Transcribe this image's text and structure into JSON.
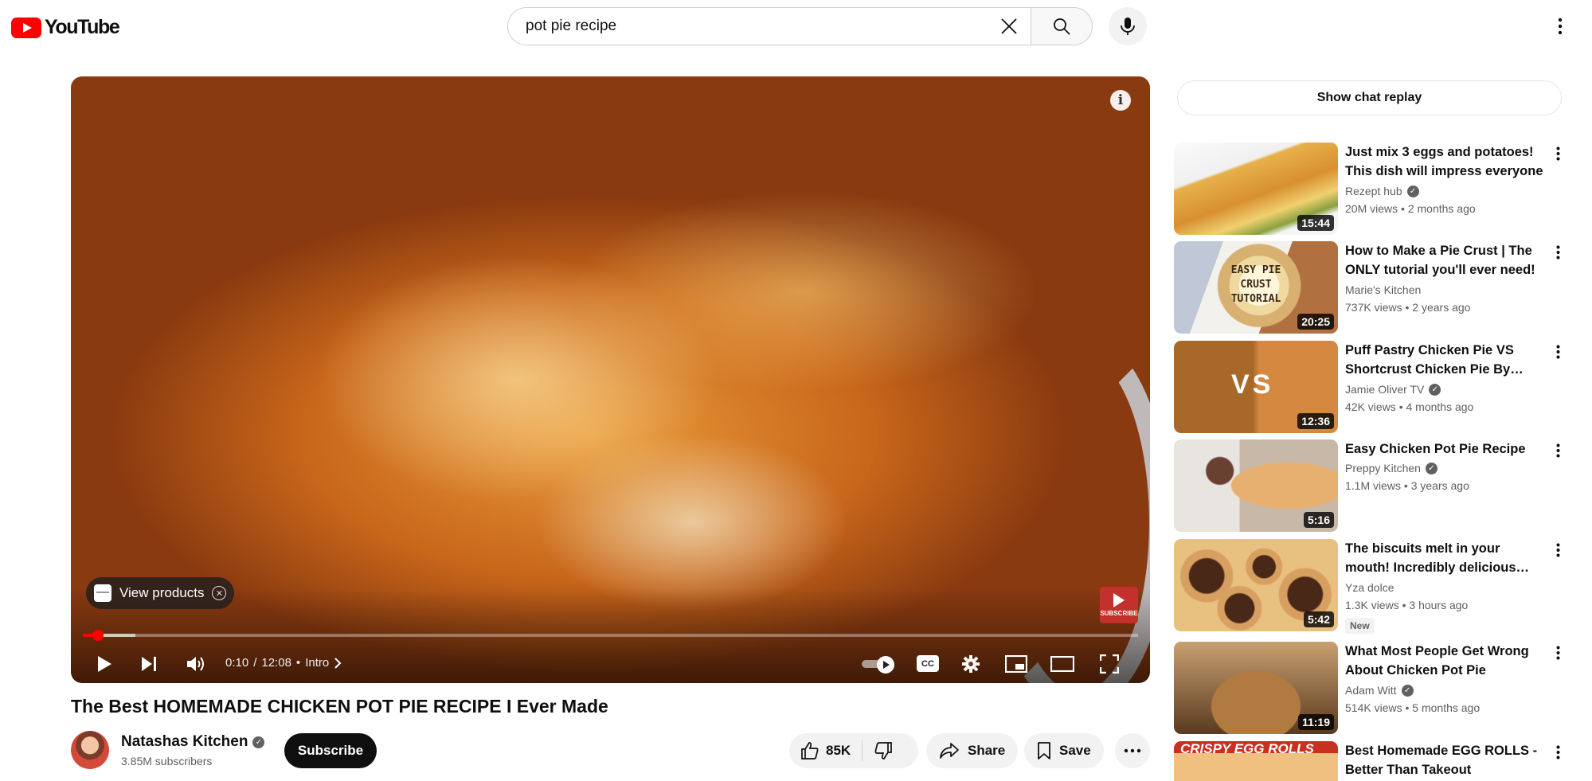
{
  "header": {
    "logo_text": "YouTube",
    "search_value": "pot pie recipe"
  },
  "player": {
    "view_products_label": "View products",
    "subscribe_badge_label": "SUBSCRIBE",
    "current_time": "0:10",
    "duration": "12:08",
    "chapter": "Intro",
    "progress_fraction": 0.014,
    "buffered_fraction": 0.05,
    "cc_label": "CC"
  },
  "video": {
    "title": "The Best HOMEMADE CHICKEN POT PIE RECIPE I Ever Made",
    "channel_name": "Natashas Kitchen",
    "subscribers": "3.85M subscribers",
    "subscribe_label": "Subscribe",
    "like_count": "85K",
    "share_label": "Share",
    "save_label": "Save"
  },
  "sidebar": {
    "chat_replay_label": "Show chat replay",
    "recommendations": [
      {
        "title": "Just mix 3 eggs and potatoes! This dish will impress everyone",
        "channel": "Rezept hub",
        "verified": true,
        "views": "20M views",
        "age": "2 months ago",
        "duration": "15:44",
        "badge": ""
      },
      {
        "title": "How to Make a Pie Crust | The ONLY tutorial you'll ever need!",
        "channel": "Marie's Kitchen",
        "verified": false,
        "views": "737K views",
        "age": "2 years ago",
        "duration": "20:25",
        "badge": "",
        "thumb_text": "EASY PIE CRUST TUTORIAL"
      },
      {
        "title": "Puff Pastry Chicken Pie VS Shortcrust Chicken Pie By Jamie Oliver",
        "channel": "Jamie Oliver TV",
        "verified": true,
        "views": "42K views",
        "age": "4 months ago",
        "duration": "12:36",
        "badge": "",
        "thumb_text": "VS"
      },
      {
        "title": "Easy Chicken Pot Pie Recipe",
        "channel": "Preppy Kitchen",
        "verified": true,
        "views": "1.1M views",
        "age": "3 years ago",
        "duration": "5:16",
        "badge": ""
      },
      {
        "title": "The biscuits melt in your mouth! Incredibly delicious with few ingredients",
        "channel": "Yza dolce",
        "verified": false,
        "views": "1.3K views",
        "age": "3 hours ago",
        "duration": "5:42",
        "badge": "New"
      },
      {
        "title": "What Most People Get Wrong About Chicken Pot Pie",
        "channel": "Adam Witt",
        "verified": true,
        "views": "514K views",
        "age": "5 months ago",
        "duration": "11:19",
        "badge": ""
      },
      {
        "title": "Best Homemade EGG ROLLS - Better Than Takeout",
        "channel": "",
        "verified": false,
        "views": "",
        "age": "",
        "duration": "",
        "badge": "",
        "thumb_text": "CRISPY EGG ROLLS"
      }
    ]
  },
  "colors": {
    "brand_red": "#ff0000",
    "text_primary": "#0f0f0f",
    "text_secondary": "#606060",
    "chip_bg": "#f2f2f2"
  }
}
